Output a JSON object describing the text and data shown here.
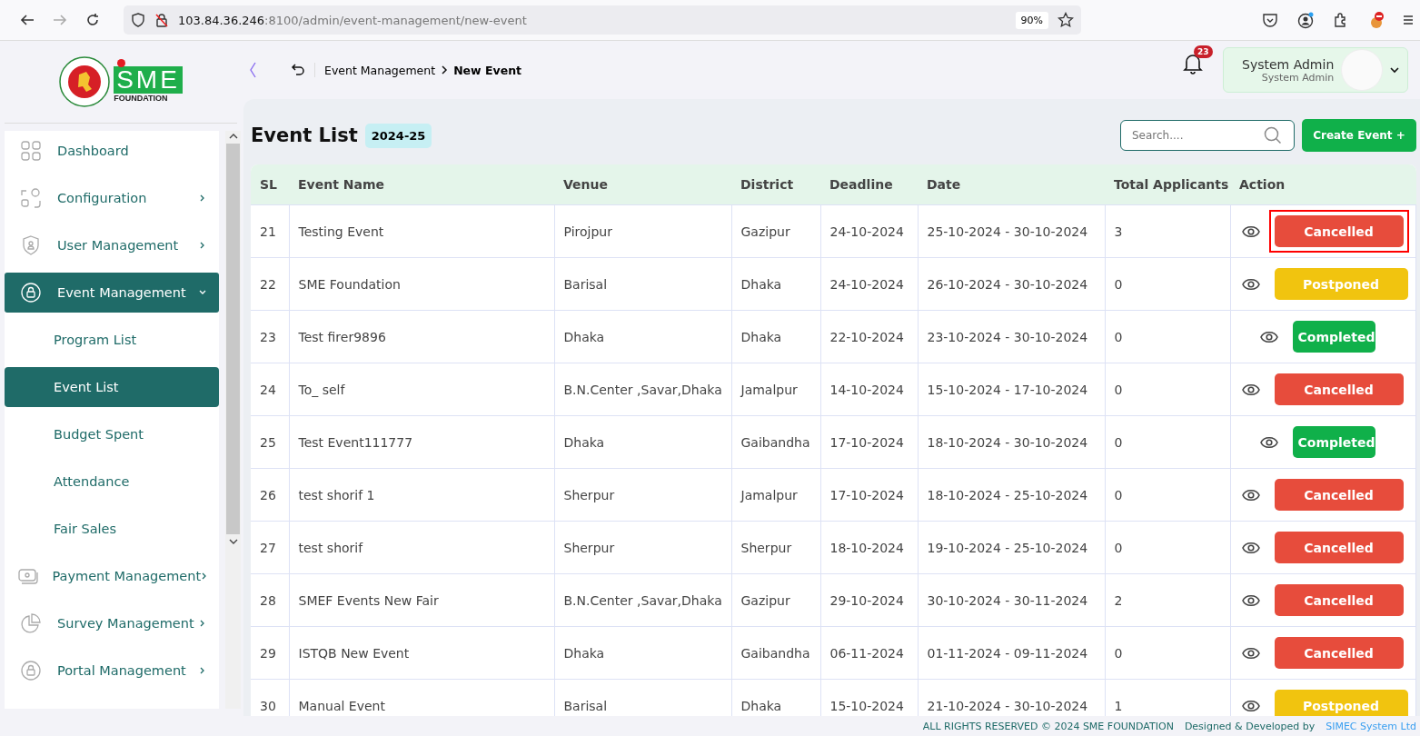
{
  "browser": {
    "url_host": "103.84.36.246",
    "url_rest": ":8100/admin/event-management/new-event",
    "zoom": "90%"
  },
  "logo": {
    "brand": "SME",
    "subtitle": "FOUNDATION"
  },
  "sidebar": {
    "items": [
      {
        "label": "Dashboard",
        "selected": false
      },
      {
        "label": "Configuration",
        "selected": false,
        "expanded": false
      },
      {
        "label": "User Management",
        "selected": false,
        "expanded": false
      },
      {
        "label": "Event Management",
        "selected": true,
        "expanded": true,
        "children": [
          {
            "label": "Program List",
            "selected": false
          },
          {
            "label": "Event List",
            "selected": true
          },
          {
            "label": "Budget Spent",
            "selected": false
          },
          {
            "label": "Attendance",
            "selected": false
          },
          {
            "label": "Fair Sales",
            "selected": false
          }
        ]
      },
      {
        "label": "Payment Management",
        "selected": false,
        "expanded": false
      },
      {
        "label": "Survey Management",
        "selected": false,
        "expanded": false
      },
      {
        "label": "Portal Management",
        "selected": false,
        "expanded": false
      }
    ]
  },
  "topbar": {
    "breadcrumb": [
      "Event Management",
      "New Event"
    ],
    "notifications": "23",
    "user_name": "System Admin",
    "user_role": "System Admin"
  },
  "page": {
    "title": "Event List",
    "year_badge": "2024-25",
    "search_placeholder": "Search....",
    "create_button": "Create Event +"
  },
  "table": {
    "columns": [
      "SL",
      "Event Name",
      "Venue",
      "District",
      "Deadline",
      "Date",
      "Total Applicants",
      "Action"
    ],
    "rows": [
      {
        "sl": "21",
        "name": "Testing Event",
        "venue": "Pirojpur",
        "district": "Gazipur",
        "deadline": "24-10-2024",
        "date": "25-10-2024 - 30-10-2024",
        "applicants": "3",
        "status": "Cancelled",
        "kind": "cancelled",
        "highlighted": true
      },
      {
        "sl": "22",
        "name": "SME Foundation",
        "venue": "Barisal",
        "district": "Dhaka",
        "deadline": "24-10-2024",
        "date": "26-10-2024 - 30-10-2024",
        "applicants": "0",
        "status": "Postponed",
        "kind": "postponed",
        "highlighted": false
      },
      {
        "sl": "23",
        "name": "Test firer9896",
        "venue": "Dhaka",
        "district": "Dhaka",
        "deadline": "22-10-2024",
        "date": "23-10-2024 - 30-10-2024",
        "applicants": "0",
        "status": "Completed",
        "kind": "completed",
        "highlighted": false
      },
      {
        "sl": "24",
        "name": "To_ self",
        "venue": "B.N.Center ,Savar,Dhaka",
        "district": "Jamalpur",
        "deadline": "14-10-2024",
        "date": "15-10-2024 - 17-10-2024",
        "applicants": "0",
        "status": "Cancelled",
        "kind": "cancelled",
        "highlighted": false
      },
      {
        "sl": "25",
        "name": "Test Event111777",
        "venue": "Dhaka",
        "district": "Gaibandha",
        "deadline": "17-10-2024",
        "date": "18-10-2024 - 30-10-2024",
        "applicants": "0",
        "status": "Completed",
        "kind": "completed",
        "highlighted": false
      },
      {
        "sl": "26",
        "name": "test shorif 1",
        "venue": "Sherpur",
        "district": "Jamalpur",
        "deadline": "17-10-2024",
        "date": "18-10-2024 - 25-10-2024",
        "applicants": "0",
        "status": "Cancelled",
        "kind": "cancelled",
        "highlighted": false
      },
      {
        "sl": "27",
        "name": "test shorif",
        "venue": "Sherpur",
        "district": "Sherpur",
        "deadline": "18-10-2024",
        "date": "19-10-2024 - 25-10-2024",
        "applicants": "0",
        "status": "Cancelled",
        "kind": "cancelled",
        "highlighted": false
      },
      {
        "sl": "28",
        "name": "SMEF Events New Fair",
        "venue": "B.N.Center ,Savar,Dhaka",
        "district": "Gazipur",
        "deadline": "29-10-2024",
        "date": "30-10-2024 - 30-11-2024",
        "applicants": "2",
        "status": "Cancelled",
        "kind": "cancelled",
        "highlighted": false
      },
      {
        "sl": "29",
        "name": "ISTQB New Event",
        "venue": "Dhaka",
        "district": "Gaibandha",
        "deadline": "06-11-2024",
        "date": "01-11-2024 - 09-11-2024",
        "applicants": "0",
        "status": "Cancelled",
        "kind": "cancelled",
        "highlighted": false
      },
      {
        "sl": "30",
        "name": "Manual Event",
        "venue": "Barisal",
        "district": "Dhaka",
        "deadline": "15-10-2024",
        "date": "21-10-2024 - 30-10-2024",
        "applicants": "1",
        "status": "Postponed",
        "kind": "postponed",
        "highlighted": false
      }
    ]
  },
  "footer": {
    "copyright": "ALL RIGHTS RESERVED © 2024 SME FOUNDATION",
    "credit": "Designed & Developed by",
    "company": "SIMEC System Ltd"
  }
}
